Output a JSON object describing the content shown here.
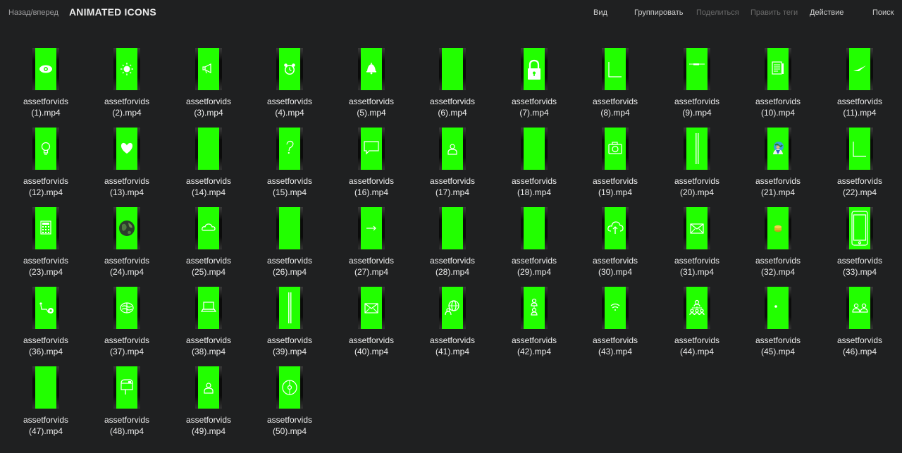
{
  "toolbar": {
    "back_forward": "Назад/вперед",
    "title": "ANIMATED ICONS",
    "view": "Вид",
    "group": "Группировать",
    "share": "Поделиться",
    "edit_tags": "Править теги",
    "action": "Действие",
    "search": "Поиск"
  },
  "colors": {
    "background": "#1f2021",
    "thumb_green": "#22ff00"
  },
  "files": [
    {
      "line1": "assetforvids",
      "line2": "(1).mp4",
      "icon": "eye-icon"
    },
    {
      "line1": "assetforvids",
      "line2": "(2).mp4",
      "icon": "sun-icon"
    },
    {
      "line1": "assetforvids",
      "line2": "(3).mp4",
      "icon": "megaphone-icon"
    },
    {
      "line1": "assetforvids",
      "line2": "(4).mp4",
      "icon": "alarm-clock-icon"
    },
    {
      "line1": "assetforvids",
      "line2": "(5).mp4",
      "icon": "bell-icon"
    },
    {
      "line1": "assetforvids",
      "line2": "(6).mp4",
      "icon": "blank"
    },
    {
      "line1": "assetforvids",
      "line2": "(7).mp4",
      "icon": "padlock-icon"
    },
    {
      "line1": "assetforvids",
      "line2": "(8).mp4",
      "icon": "corner-line-icon"
    },
    {
      "line1": "assetforvids",
      "line2": "(9).mp4",
      "icon": "line-bar-icon"
    },
    {
      "line1": "assetforvids",
      "line2": "(10).mp4",
      "icon": "notepad-icon"
    },
    {
      "line1": "assetforvids",
      "line2": "(11).mp4",
      "icon": "check-stroke-icon"
    },
    {
      "line1": "assetforvids",
      "line2": "(12).mp4",
      "icon": "lightbulb-icon"
    },
    {
      "line1": "assetforvids",
      "line2": "(13).mp4",
      "icon": "heart-icon"
    },
    {
      "line1": "assetforvids",
      "line2": "(14).mp4",
      "icon": "blank"
    },
    {
      "line1": "assetforvids",
      "line2": "(15).mp4",
      "icon": "question-mark-icon"
    },
    {
      "line1": "assetforvids",
      "line2": "(16).mp4",
      "icon": "chat-bubble-icon"
    },
    {
      "line1": "assetforvids",
      "line2": "(17).mp4",
      "icon": "person-icon"
    },
    {
      "line1": "assetforvids",
      "line2": "(18).mp4",
      "icon": "blank"
    },
    {
      "line1": "assetforvids",
      "line2": "(19).mp4",
      "icon": "camera-icon"
    },
    {
      "line1": "assetforvids",
      "line2": "(20).mp4",
      "icon": "vertical-bar-icon"
    },
    {
      "line1": "assetforvids",
      "line2": "(21).mp4",
      "icon": "person-globe-icon"
    },
    {
      "line1": "assetforvids",
      "line2": "(22).mp4",
      "icon": "corner-line-icon"
    },
    {
      "line1": "assetforvids",
      "line2": "(23).mp4",
      "icon": "calculator-icon"
    },
    {
      "line1": "assetforvids",
      "line2": "(24).mp4",
      "icon": "earth-icon"
    },
    {
      "line1": "assetforvids",
      "line2": "(25).mp4",
      "icon": "cloud-icon"
    },
    {
      "line1": "assetforvids",
      "line2": "(26).mp4",
      "icon": "blank"
    },
    {
      "line1": "assetforvids",
      "line2": "(27).mp4",
      "icon": "arrow-right-icon"
    },
    {
      "line1": "assetforvids",
      "line2": "(28).mp4",
      "icon": "blank"
    },
    {
      "line1": "assetforvids",
      "line2": "(29).mp4",
      "icon": "blank"
    },
    {
      "line1": "assetforvids",
      "line2": "(30).mp4",
      "icon": "cloud-upload-icon"
    },
    {
      "line1": "assetforvids",
      "line2": "(31).mp4",
      "icon": "envelope-icon"
    },
    {
      "line1": "assetforvids",
      "line2": "(32).mp4",
      "icon": "coins-icon"
    },
    {
      "line1": "assetforvids",
      "line2": "(33).mp4",
      "icon": "smartphone-icon"
    },
    {
      "line1": "assetforvids",
      "line2": "(36).mp4",
      "icon": "wheelchair-icon"
    },
    {
      "line1": "assetforvids",
      "line2": "(37).mp4",
      "icon": "brain-icon"
    },
    {
      "line1": "assetforvids",
      "line2": "(38).mp4",
      "icon": "laptop-icon"
    },
    {
      "line1": "assetforvids",
      "line2": "(39).mp4",
      "icon": "vertical-bar-icon"
    },
    {
      "line1": "assetforvids",
      "line2": "(40).mp4",
      "icon": "envelope-icon"
    },
    {
      "line1": "assetforvids",
      "line2": "(41).mp4",
      "icon": "globe-people-icon"
    },
    {
      "line1": "assetforvids",
      "line2": "(42).mp4",
      "icon": "org-chart-icon"
    },
    {
      "line1": "assetforvids",
      "line2": "(43).mp4",
      "icon": "wifi-icon"
    },
    {
      "line1": "assetforvids",
      "line2": "(44).mp4",
      "icon": "network-people-icon"
    },
    {
      "line1": "assetforvids",
      "line2": "(45).mp4",
      "icon": "dot-icon"
    },
    {
      "line1": "assetforvids",
      "line2": "(46).mp4",
      "icon": "two-people-icon"
    },
    {
      "line1": "assetforvids",
      "line2": "(47).mp4",
      "icon": "blank"
    },
    {
      "line1": "assetforvids",
      "line2": "(48).mp4",
      "icon": "mailbox-icon"
    },
    {
      "line1": "assetforvids",
      "line2": "(49).mp4",
      "icon": "person-icon"
    },
    {
      "line1": "assetforvids",
      "line2": "(50).mp4",
      "icon": "compass-icon"
    }
  ]
}
